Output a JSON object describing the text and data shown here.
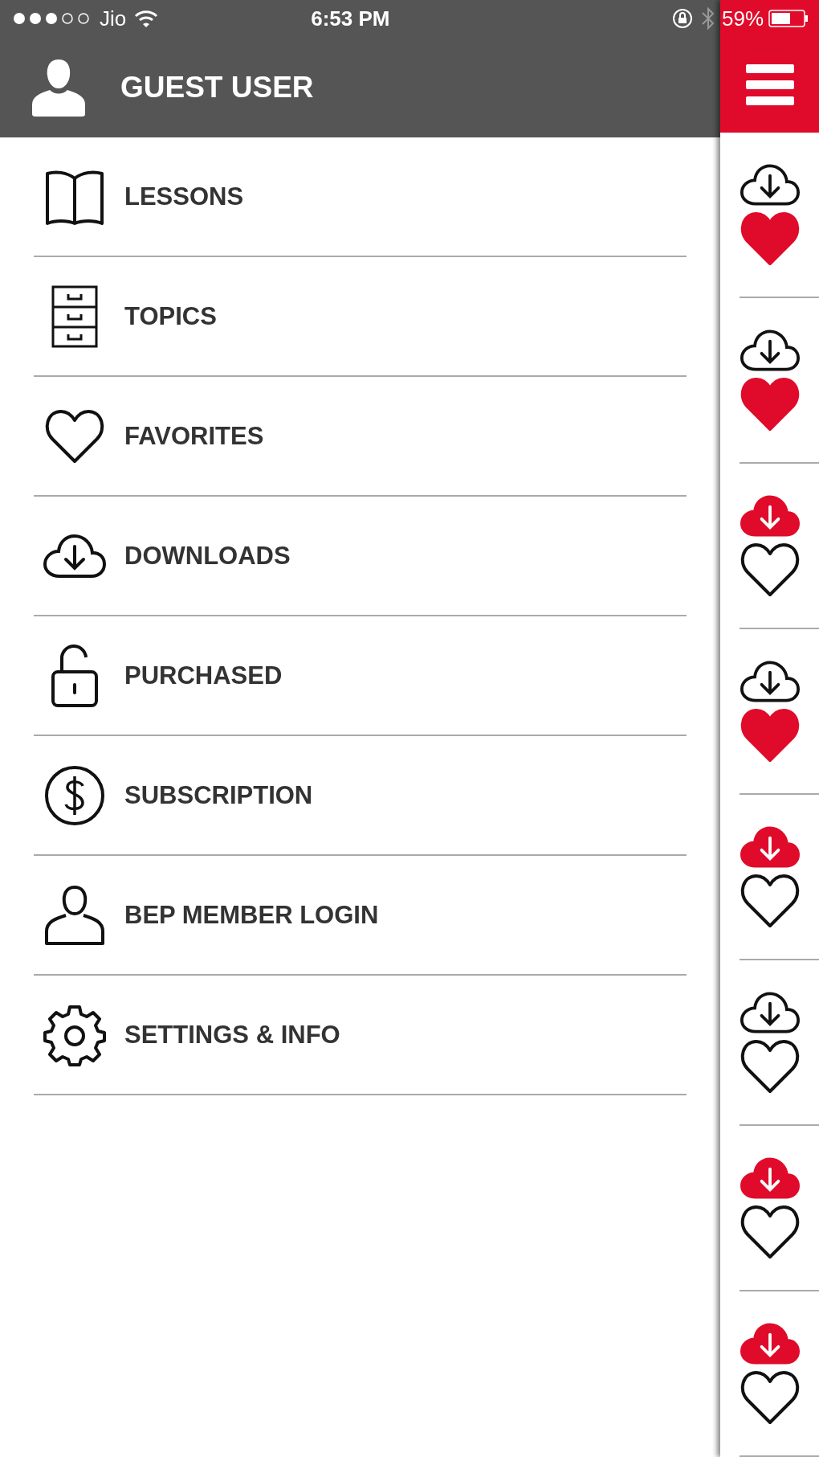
{
  "status_bar": {
    "carrier": "Jio",
    "time": "6:53 PM",
    "battery": "59%"
  },
  "header": {
    "title": "GUEST USER"
  },
  "menu": [
    {
      "kind": "book",
      "label": "LESSONS"
    },
    {
      "kind": "drawers",
      "label": "TOPICS"
    },
    {
      "kind": "heart",
      "label": "FAVORITES"
    },
    {
      "kind": "cloud",
      "label": "DOWNLOADS"
    },
    {
      "kind": "lock",
      "label": "PURCHASED"
    },
    {
      "kind": "dollar",
      "label": "SUBSCRIPTION"
    },
    {
      "kind": "person",
      "label": "BEP MEMBER LOGIN"
    },
    {
      "kind": "gear",
      "label": "SETTINGS & INFO"
    }
  ],
  "lesson_list": [
    {
      "downloaded": false,
      "favorite": true
    },
    {
      "downloaded": false,
      "favorite": true
    },
    {
      "downloaded": true,
      "favorite": false
    },
    {
      "downloaded": false,
      "favorite": true
    },
    {
      "downloaded": true,
      "favorite": false
    },
    {
      "downloaded": false,
      "favorite": false
    },
    {
      "downloaded": true,
      "favorite": false
    },
    {
      "downloaded": true,
      "favorite": false
    }
  ]
}
